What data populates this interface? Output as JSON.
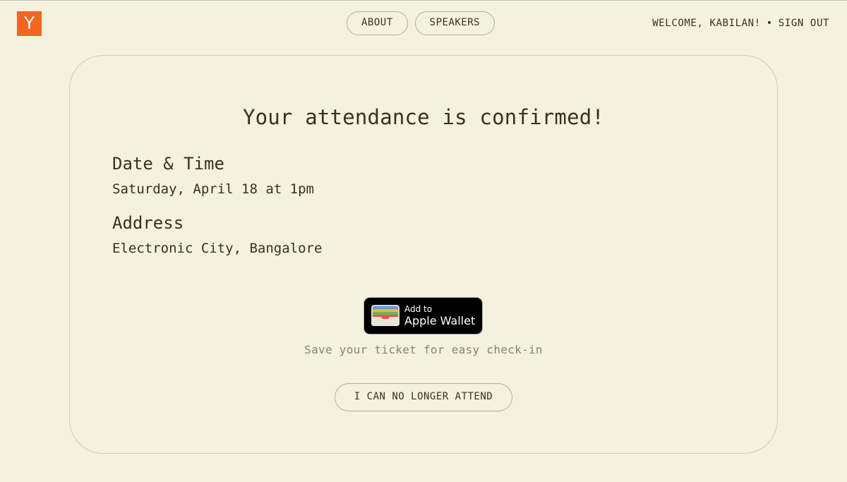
{
  "brand": {
    "logo_letter": "Y",
    "logo_color": "#f26522"
  },
  "nav": {
    "items": [
      {
        "label": "ABOUT"
      },
      {
        "label": "SPEAKERS"
      }
    ]
  },
  "account": {
    "welcome_text": "WELCOME, KABILAN!",
    "separator": "•",
    "sign_out_label": "SIGN OUT"
  },
  "confirmation": {
    "title": "Your attendance is confirmed!",
    "date_heading": "Date & Time",
    "date_value": "Saturday, April 18 at 1pm",
    "address_heading": "Address",
    "address_value": "Electronic City, Bangalore"
  },
  "wallet": {
    "small_label": "Add to",
    "big_label": "Apple Wallet",
    "caption": "Save your ticket for easy check-in"
  },
  "actions": {
    "cancel_label": "I CAN NO LONGER ATTEND"
  },
  "colors": {
    "background": "#f4f1dd",
    "text": "#3b2f22",
    "muted_text": "#8a8270",
    "border": "#b3ad98"
  }
}
